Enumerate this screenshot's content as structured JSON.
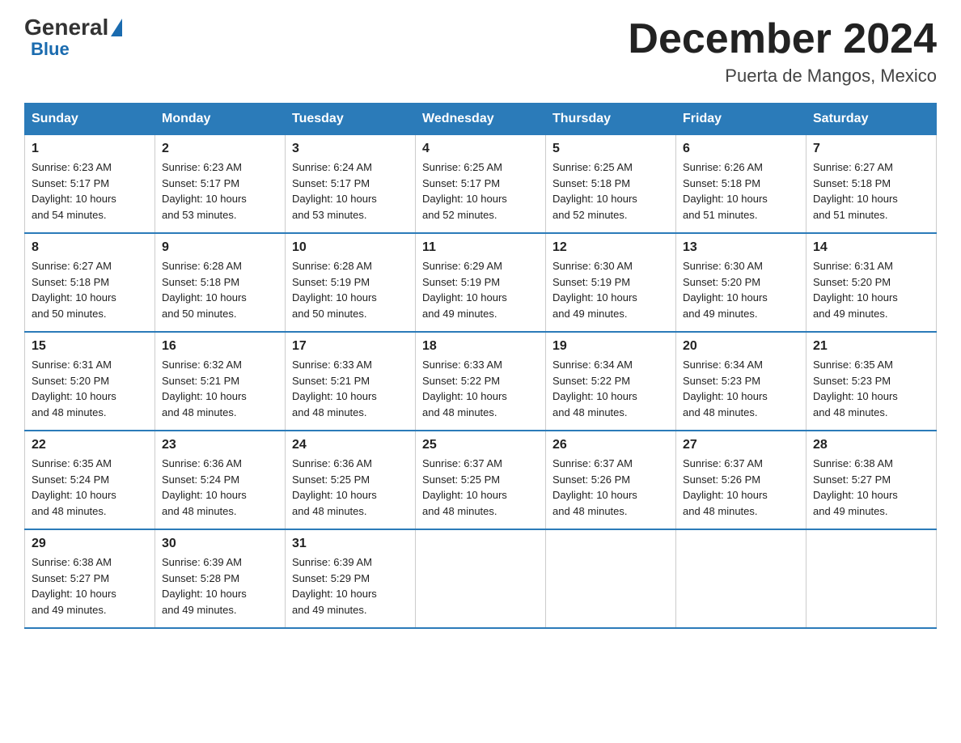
{
  "header": {
    "logo_general": "General",
    "logo_blue": "Blue",
    "title": "December 2024",
    "subtitle": "Puerta de Mangos, Mexico"
  },
  "days_of_week": [
    "Sunday",
    "Monday",
    "Tuesday",
    "Wednesday",
    "Thursday",
    "Friday",
    "Saturday"
  ],
  "weeks": [
    [
      {
        "day": "1",
        "sunrise": "6:23 AM",
        "sunset": "5:17 PM",
        "daylight": "10 hours and 54 minutes."
      },
      {
        "day": "2",
        "sunrise": "6:23 AM",
        "sunset": "5:17 PM",
        "daylight": "10 hours and 53 minutes."
      },
      {
        "day": "3",
        "sunrise": "6:24 AM",
        "sunset": "5:17 PM",
        "daylight": "10 hours and 53 minutes."
      },
      {
        "day": "4",
        "sunrise": "6:25 AM",
        "sunset": "5:17 PM",
        "daylight": "10 hours and 52 minutes."
      },
      {
        "day": "5",
        "sunrise": "6:25 AM",
        "sunset": "5:18 PM",
        "daylight": "10 hours and 52 minutes."
      },
      {
        "day": "6",
        "sunrise": "6:26 AM",
        "sunset": "5:18 PM",
        "daylight": "10 hours and 51 minutes."
      },
      {
        "day": "7",
        "sunrise": "6:27 AM",
        "sunset": "5:18 PM",
        "daylight": "10 hours and 51 minutes."
      }
    ],
    [
      {
        "day": "8",
        "sunrise": "6:27 AM",
        "sunset": "5:18 PM",
        "daylight": "10 hours and 50 minutes."
      },
      {
        "day": "9",
        "sunrise": "6:28 AM",
        "sunset": "5:18 PM",
        "daylight": "10 hours and 50 minutes."
      },
      {
        "day": "10",
        "sunrise": "6:28 AM",
        "sunset": "5:19 PM",
        "daylight": "10 hours and 50 minutes."
      },
      {
        "day": "11",
        "sunrise": "6:29 AM",
        "sunset": "5:19 PM",
        "daylight": "10 hours and 49 minutes."
      },
      {
        "day": "12",
        "sunrise": "6:30 AM",
        "sunset": "5:19 PM",
        "daylight": "10 hours and 49 minutes."
      },
      {
        "day": "13",
        "sunrise": "6:30 AM",
        "sunset": "5:20 PM",
        "daylight": "10 hours and 49 minutes."
      },
      {
        "day": "14",
        "sunrise": "6:31 AM",
        "sunset": "5:20 PM",
        "daylight": "10 hours and 49 minutes."
      }
    ],
    [
      {
        "day": "15",
        "sunrise": "6:31 AM",
        "sunset": "5:20 PM",
        "daylight": "10 hours and 48 minutes."
      },
      {
        "day": "16",
        "sunrise": "6:32 AM",
        "sunset": "5:21 PM",
        "daylight": "10 hours and 48 minutes."
      },
      {
        "day": "17",
        "sunrise": "6:33 AM",
        "sunset": "5:21 PM",
        "daylight": "10 hours and 48 minutes."
      },
      {
        "day": "18",
        "sunrise": "6:33 AM",
        "sunset": "5:22 PM",
        "daylight": "10 hours and 48 minutes."
      },
      {
        "day": "19",
        "sunrise": "6:34 AM",
        "sunset": "5:22 PM",
        "daylight": "10 hours and 48 minutes."
      },
      {
        "day": "20",
        "sunrise": "6:34 AM",
        "sunset": "5:23 PM",
        "daylight": "10 hours and 48 minutes."
      },
      {
        "day": "21",
        "sunrise": "6:35 AM",
        "sunset": "5:23 PM",
        "daylight": "10 hours and 48 minutes."
      }
    ],
    [
      {
        "day": "22",
        "sunrise": "6:35 AM",
        "sunset": "5:24 PM",
        "daylight": "10 hours and 48 minutes."
      },
      {
        "day": "23",
        "sunrise": "6:36 AM",
        "sunset": "5:24 PM",
        "daylight": "10 hours and 48 minutes."
      },
      {
        "day": "24",
        "sunrise": "6:36 AM",
        "sunset": "5:25 PM",
        "daylight": "10 hours and 48 minutes."
      },
      {
        "day": "25",
        "sunrise": "6:37 AM",
        "sunset": "5:25 PM",
        "daylight": "10 hours and 48 minutes."
      },
      {
        "day": "26",
        "sunrise": "6:37 AM",
        "sunset": "5:26 PM",
        "daylight": "10 hours and 48 minutes."
      },
      {
        "day": "27",
        "sunrise": "6:37 AM",
        "sunset": "5:26 PM",
        "daylight": "10 hours and 48 minutes."
      },
      {
        "day": "28",
        "sunrise": "6:38 AM",
        "sunset": "5:27 PM",
        "daylight": "10 hours and 49 minutes."
      }
    ],
    [
      {
        "day": "29",
        "sunrise": "6:38 AM",
        "sunset": "5:27 PM",
        "daylight": "10 hours and 49 minutes."
      },
      {
        "day": "30",
        "sunrise": "6:39 AM",
        "sunset": "5:28 PM",
        "daylight": "10 hours and 49 minutes."
      },
      {
        "day": "31",
        "sunrise": "6:39 AM",
        "sunset": "5:29 PM",
        "daylight": "10 hours and 49 minutes."
      },
      null,
      null,
      null,
      null
    ]
  ],
  "labels": {
    "sunrise": "Sunrise:",
    "sunset": "Sunset:",
    "daylight": "Daylight:"
  },
  "colors": {
    "header_bg": "#2b7bb9",
    "header_text": "#ffffff",
    "border": "#2b7bb9",
    "cell_border": "#cccccc"
  }
}
